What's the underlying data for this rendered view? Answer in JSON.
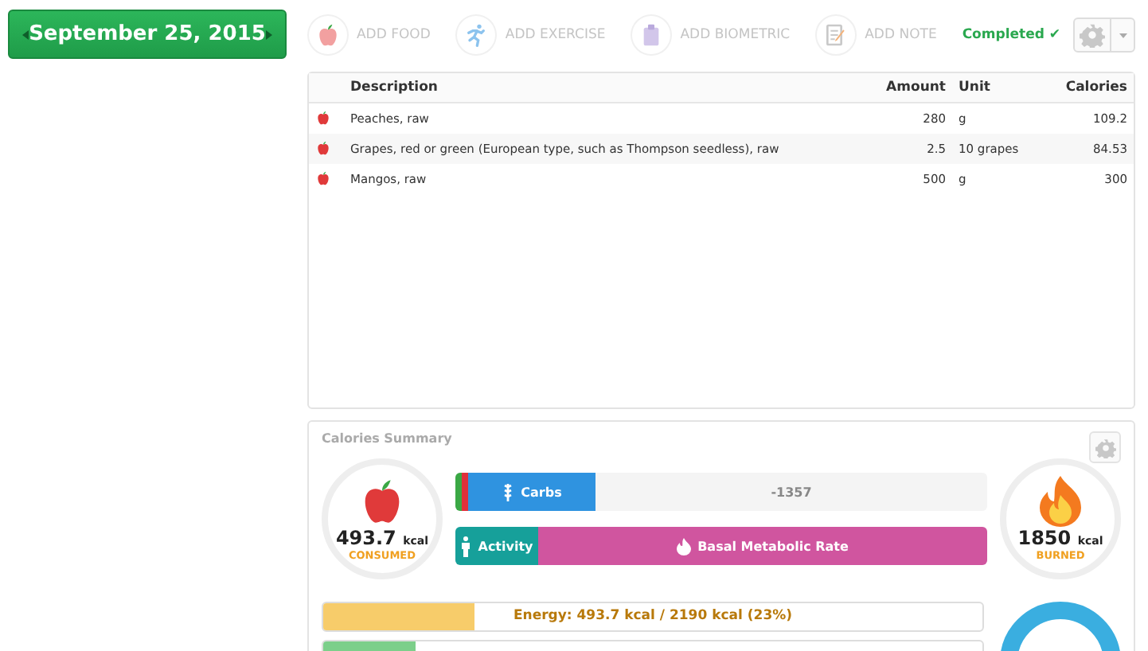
{
  "date_nav": {
    "label": "September 25, 2015"
  },
  "toolbar": {
    "actions": [
      {
        "kind": "food",
        "label": "ADD FOOD"
      },
      {
        "kind": "exercise",
        "label": "ADD EXERCISE"
      },
      {
        "kind": "biometric",
        "label": "ADD BIOMETRIC"
      },
      {
        "kind": "note",
        "label": "ADD NOTE"
      }
    ],
    "status": "Completed ✔"
  },
  "table": {
    "columns": [
      "Description",
      "Amount",
      "Unit",
      "Calories"
    ],
    "rows": [
      {
        "description": "Peaches, raw",
        "amount": "280",
        "unit": "g",
        "calories": "109.2"
      },
      {
        "description": "Grapes, red or green (European type, such as Thompson seedless), raw",
        "amount": "2.5",
        "unit": "10 grapes",
        "calories": "84.53"
      },
      {
        "description": "Mangos, raw",
        "amount": "500",
        "unit": "g",
        "calories": "300"
      }
    ]
  },
  "summary": {
    "title": "Calories Summary",
    "consumed": {
      "value": "493.7",
      "unit": "kcal",
      "label": "CONSUMED"
    },
    "burned": {
      "value": "1850",
      "unit": "kcal",
      "label": "BURNED"
    },
    "intake_bar": {
      "segments": [
        {
          "kind": "stripe",
          "color": "#3aa845"
        },
        {
          "kind": "stripe",
          "color": "#e0303a"
        },
        {
          "kind": "carbs",
          "label": "Carbs",
          "color": "#2f93e0"
        }
      ],
      "remainder": "-1357"
    },
    "burn_bar": {
      "segments": [
        {
          "kind": "activity",
          "label": "Activity",
          "color": "#16a09a"
        },
        {
          "kind": "bmr",
          "label": "Basal Metabolic Rate",
          "color": "#d0559f"
        }
      ]
    },
    "targets": [
      {
        "label": "Energy: 493.7 kcal / 2190 kcal (23%)",
        "color": "#f7cc6a",
        "level": 0.23
      },
      {
        "color": "#7ccf8a",
        "level": 0.14
      }
    ]
  }
}
